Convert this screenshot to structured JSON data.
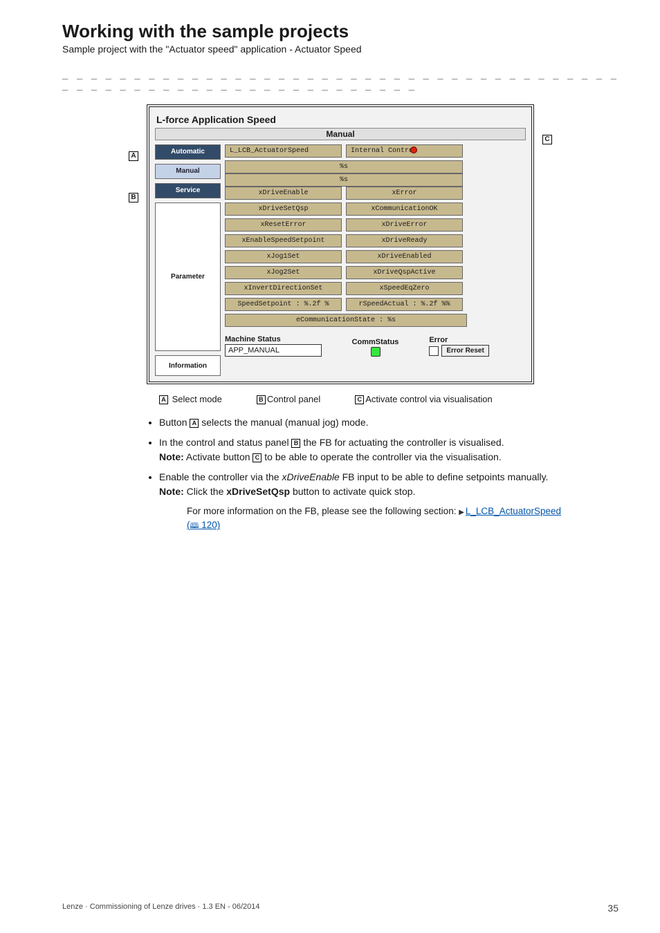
{
  "heading": "Working with the sample projects",
  "subheading": "Sample project with the \"Actuator speed\" application - Actuator Speed",
  "dashline": "_ _ _ _ _ _ _ _ _ _ _ _ _ _ _ _ _ _ _ _ _ _ _ _ _ _ _ _ _ _ _ _ _ _ _ _ _ _ _ _ _ _ _ _ _ _ _ _ _ _ _ _ _ _ _ _ _ _ _ _ _ _ _ _",
  "ss": {
    "title": "L-force Application Speed",
    "manual_header": "Manual",
    "fb_name": "L_LCB_ActuatorSpeed",
    "internal_control": "Internal Control",
    "tabs": {
      "auto": "Automatic",
      "manual": "Manual",
      "service": "Service"
    },
    "param_label": "Parameter",
    "info_label": "Information",
    "placeholder_s": "%s",
    "rows": [
      {
        "l": "xDriveEnable",
        "r": "xError"
      },
      {
        "l": "xDriveSetQsp",
        "r": "xCommunicationOK"
      },
      {
        "l": "xResetError",
        "r": "xDriveError"
      },
      {
        "l": "xEnableSpeedSetpoint",
        "r": "xDriveReady"
      },
      {
        "l": "xJog1Set",
        "r": "xDriveEnabled"
      },
      {
        "l": "xJog2Set",
        "r": "xDriveQspActive"
      },
      {
        "l": "xInvertDirectionSet",
        "r": "xSpeedEqZero"
      },
      {
        "l": "SpeedSetpoint : %.2f %",
        "r": "rSpeedActual : %.2f %%"
      }
    ],
    "comm_state": "eCommunicationState : %s",
    "status": {
      "machine_label": "Machine Status",
      "machine_val": "APP_MANUAL",
      "comm_label": "CommStatus",
      "error_label": "Error",
      "error_reset": "Error Reset"
    }
  },
  "callouts": {
    "a": "A",
    "b": "B",
    "c": "C"
  },
  "legend": {
    "a": "Select mode",
    "b": "Control panel",
    "c": "Activate control via visualisation"
  },
  "bullets": {
    "b1_a": "Button ",
    "b1_b": " selects the manual (manual jog) mode.",
    "b2_a": "In the control and status panel ",
    "b2_b": " the FB for actuating the controller is visualised.",
    "b2_note_a": "Note:",
    "b2_note_b": " Activate button ",
    "b2_note_c": " to be able to operate the controller via the visualisation.",
    "b3_a": "Enable the controller via the ",
    "b3_i": "xDriveEnable",
    "b3_b": " FB input to be able to define setpoints manually.",
    "b3_note_a": "Note:",
    "b3_note_b": " Click the ",
    "b3_note_bold": "xDriveSetQsp",
    "b3_note_c": " button to activate quick stop.",
    "more_a": "For more information on the FB, please see the following section: ",
    "more_link": "L_LCB_ActuatorSpeed",
    "more_ref": " 120)"
  },
  "footer": {
    "left": "Lenze · Commissioning of Lenze drives · 1.3 EN - 06/2014",
    "page": "35"
  }
}
